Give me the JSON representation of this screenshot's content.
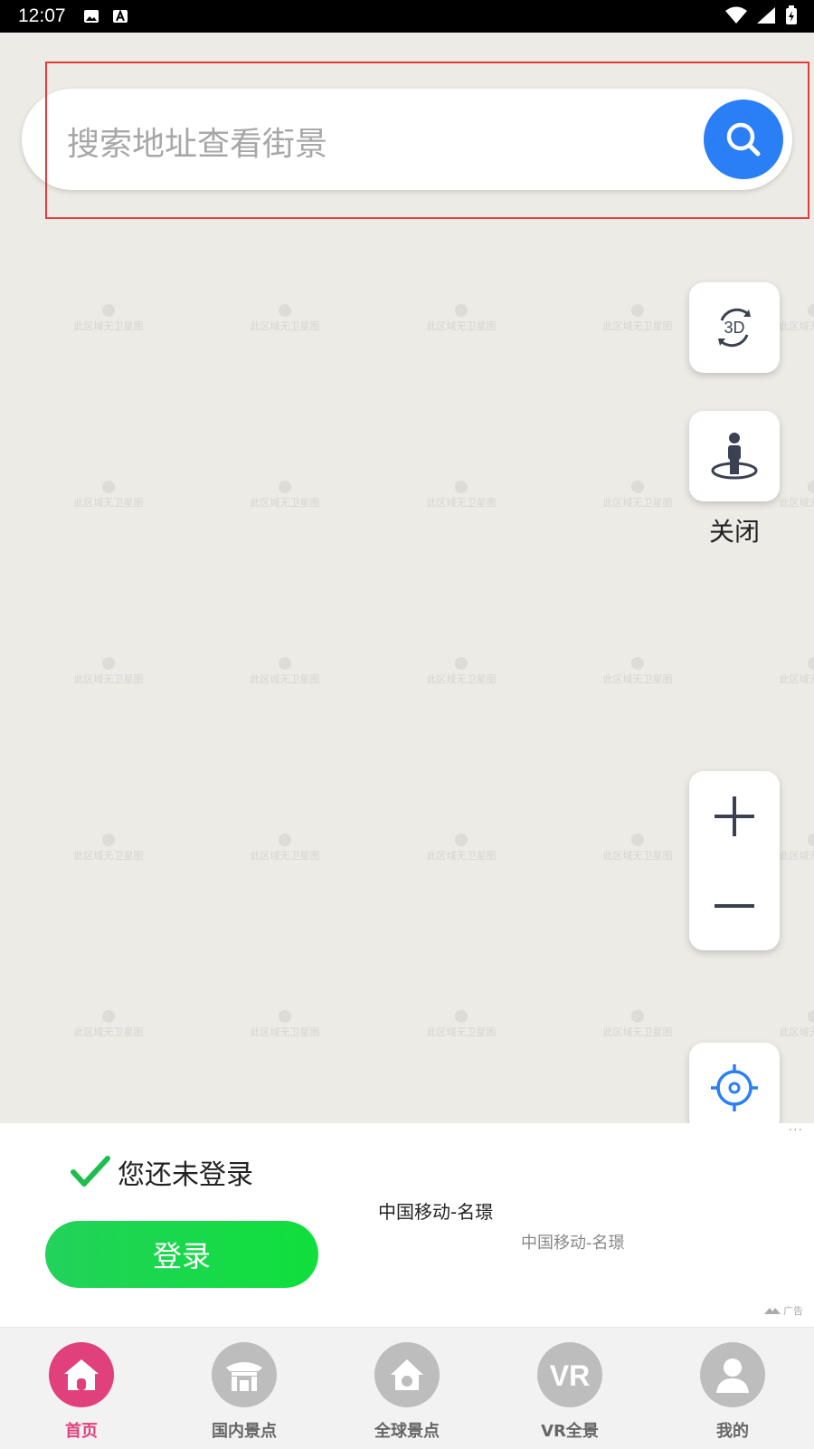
{
  "status_bar": {
    "time": "12:07"
  },
  "search": {
    "placeholder": "搜索地址查看街景"
  },
  "map": {
    "watermark_text": "此区域无卫星图",
    "controls": {
      "close_label": "关闭"
    }
  },
  "login_panel": {
    "status_text": "您还未登录",
    "login_button": "登录"
  },
  "ad": {
    "title": "中国移动-名璟",
    "subtitle": "中国移动-名璟",
    "label": "广告",
    "more": "···"
  },
  "nav": {
    "items": [
      {
        "label": "首页",
        "icon": "home-icon",
        "active": true
      },
      {
        "label": "国内景点",
        "icon": "temple-icon",
        "active": false
      },
      {
        "label": "全球景点",
        "icon": "globe-house-icon",
        "active": false
      },
      {
        "label": "VR全景",
        "icon": "vr-icon",
        "active": false
      },
      {
        "label": "我的",
        "icon": "person-icon",
        "active": false
      }
    ]
  },
  "colors": {
    "accent_blue": "#2a7ef6",
    "login_green": "#1bd94a",
    "nav_active": "#e0407c",
    "highlight_red": "#e23c3c"
  }
}
